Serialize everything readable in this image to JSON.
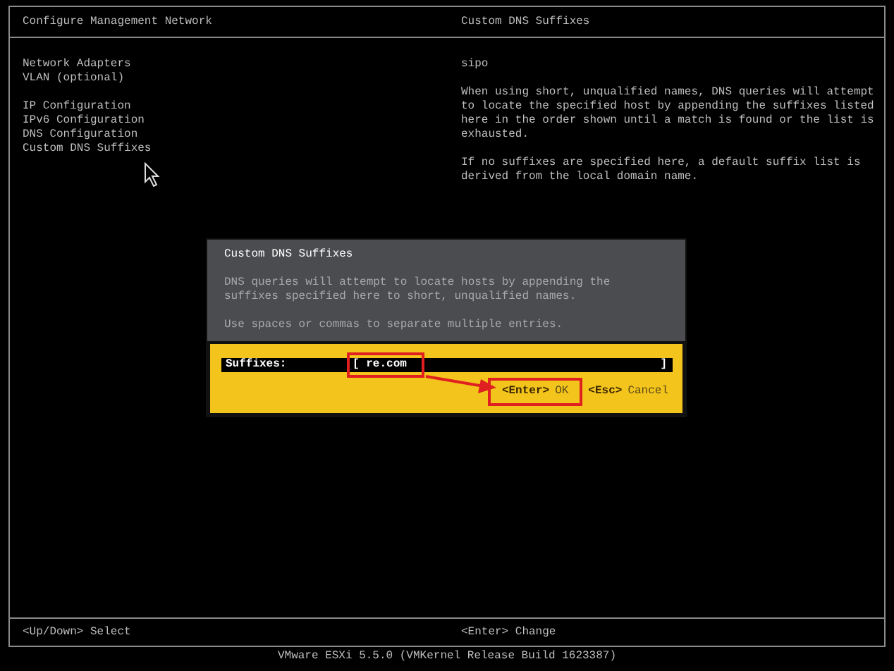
{
  "left_panel": {
    "title": "Configure Management Network",
    "groups": [
      [
        "Network Adapters",
        "VLAN (optional)"
      ],
      [
        "IP Configuration",
        "IPv6 Configuration",
        "DNS Configuration",
        "Custom DNS Suffixes"
      ]
    ]
  },
  "right_panel": {
    "title": "Custom DNS Suffixes",
    "value": "sipo",
    "paragraphs": [
      "When using short, unqualified names, DNS queries will attempt to locate the specified host by appending the suffixes listed here in the order shown until a match is found or the list is exhausted.",
      "If no suffixes are specified here, a default suffix list is derived from the local domain name."
    ]
  },
  "dialog": {
    "title": "Custom DNS Suffixes",
    "paragraphs": [
      "DNS queries will attempt to locate hosts by appending the suffixes specified here to short, unqualified names.",
      "Use spaces or commas to separate multiple entries."
    ],
    "field": {
      "label": "Suffixes:",
      "open": "[",
      "value": "re.com",
      "close": "]",
      "annotated": true
    },
    "buttons": [
      {
        "key": "<Enter>",
        "label": "OK",
        "annotated": true
      },
      {
        "key": "<Esc>",
        "label": "Cancel",
        "annotated": false
      }
    ]
  },
  "footer": {
    "left": "<Up/Down> Select",
    "right": "<Enter> Change"
  },
  "status_bar": "VMware ESXi 5.5.0 (VMKernel Release Build 1623387)"
}
